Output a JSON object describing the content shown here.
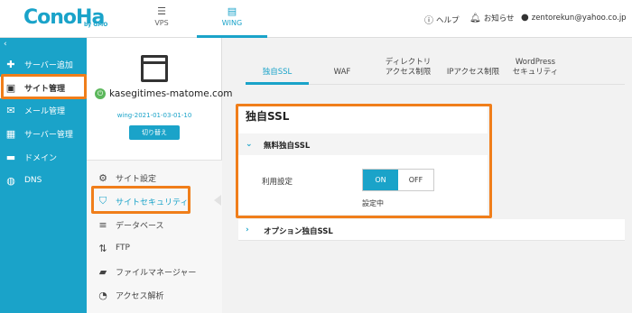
{
  "header": {
    "logo": "ConoHa",
    "logo_sub": "by GMO",
    "tabs": [
      {
        "label": "VPS",
        "icon": "server-icon"
      },
      {
        "label": "WING",
        "icon": "wing-icon"
      }
    ],
    "help": "ヘルプ",
    "notice": "お知らせ",
    "user": "zentorekun@yahoo.co.jp",
    "accent": "#1aa3c9"
  },
  "sidenav": {
    "collapse": "‹",
    "items": [
      {
        "label": "サーバー追加",
        "icon": "plus-icon"
      },
      {
        "label": "サイト管理",
        "icon": "site-icon"
      },
      {
        "label": "メール管理",
        "icon": "mail-icon"
      },
      {
        "label": "サーバー管理",
        "icon": "server-icon"
      },
      {
        "label": "ドメイン",
        "icon": "domain-icon"
      },
      {
        "label": "DNS",
        "icon": "globe-icon"
      }
    ]
  },
  "site": {
    "domain": "kasegitimes-matome.com",
    "id": "wing-2021-01-03-01-10",
    "switch_label": "切り替え"
  },
  "submenu": [
    {
      "label": "サイト設定",
      "icon": "settings-icon"
    },
    {
      "label": "サイトセキュリティ",
      "icon": "shield-icon"
    },
    {
      "label": "データベース",
      "icon": "database-icon"
    },
    {
      "label": "FTP",
      "icon": "transfer-icon"
    },
    {
      "label": "ファイルマネージャー",
      "icon": "folder-icon"
    },
    {
      "label": "アクセス解析",
      "icon": "pie-chart-icon"
    }
  ],
  "content_tabs": [
    {
      "line1": "独自SSL",
      "line2": ""
    },
    {
      "line1": "WAF",
      "line2": ""
    },
    {
      "line1": "ディレクトリ",
      "line2": "アクセス制限"
    },
    {
      "line1": "IPアクセス制限",
      "line2": ""
    },
    {
      "line1": "WordPress",
      "line2": "セキュリティ"
    }
  ],
  "ssl": {
    "title": "独自SSL",
    "free_section": "無料独自SSL",
    "use_label": "利用設定",
    "on": "ON",
    "off": "OFF",
    "status": "設定中",
    "option_section": "オプション独自SSL"
  },
  "highlight_color": "#f07e1a"
}
